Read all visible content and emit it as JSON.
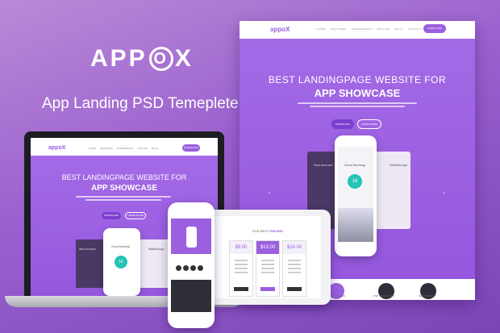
{
  "brand": {
    "pre": "APP",
    "o": "O",
    "post": "X"
  },
  "subtitle": "App Landing PSD Temeplete",
  "site": {
    "logo": "appoX",
    "nav_links": [
      "HOME",
      "FEATURES",
      "SCREENSHOT",
      "PRICING",
      "BLOG",
      "CONTACT"
    ],
    "nav_button": "DOWNLOAD",
    "headline1": "BEST LANDINGPAGE WEBSITE FOR",
    "headline2": "APP SHOWCASE",
    "btn_primary": "DOWNLOAD",
    "btn_secondary": "LEARN MORE",
    "phone": {
      "greeting": "Good Morning!",
      "ring_value": "16",
      "left_card": "New Account",
      "right_card": "Walkthrough"
    },
    "features": [
      "EASY CUSTOMIZATION",
      "PSD IS INCLUDED",
      "SEO FRIENDLY"
    ],
    "pricing_title_pre": "OUR BEST ",
    "pricing_title_accent": "PRICING",
    "prices": [
      "$9.00",
      "$13.00",
      "$24.00"
    ]
  },
  "colors": {
    "accent": "#9b5fe0",
    "teal": "#23c4b4",
    "dark": "#2e2e38"
  }
}
